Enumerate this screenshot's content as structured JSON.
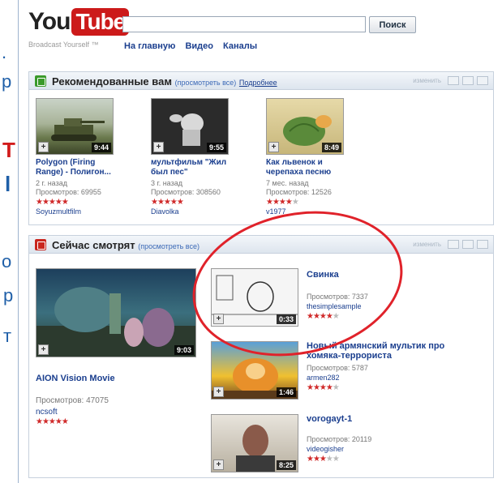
{
  "slide_fragments": {
    "frag1": ".",
    "frag2": "р",
    "frag3": "Т",
    "frag4": "l",
    "frag5": "о",
    "frag6": "р",
    "frag7": "т"
  },
  "header": {
    "logo_you": "You",
    "logo_tube": "Tube",
    "tagline": "Broadcast Yourself ™",
    "search_value": "",
    "search_button": "Поиск",
    "nav": [
      "На главную",
      "Видео",
      "Каналы"
    ]
  },
  "recommended": {
    "title": "Рекомендованные вам",
    "see_all": "(просмотреть все)",
    "more": "Подробнее",
    "edit": "изменить",
    "videos": [
      {
        "title1": "Polygon (Firing",
        "title2": "Range) - Полигон...",
        "age": "2 г. назад",
        "views": "Просмотров: 69955",
        "user": "Soyuzmultfilm",
        "duration": "9:44",
        "rating": 5
      },
      {
        "title1": "мультфильм \"Жил",
        "title2": "был пес\"",
        "age": "3 г. назад",
        "views": "Просмотров: 308560",
        "user": "Diavolka",
        "duration": "9:55",
        "rating": 5
      },
      {
        "title1": "Как львенок и",
        "title2": "черепаха песню",
        "age": "7 мес. назад",
        "views": "Просмотров: 12526",
        "user": "v1977",
        "duration": "8:49",
        "rating": 4.5
      }
    ]
  },
  "now_watching": {
    "title": "Сейчас смотрят",
    "see_all": "(просмотреть все)",
    "edit": "изменить",
    "main": {
      "title": "AION Vision Movie",
      "views": "Просмотров: 47075",
      "user": "ncsoft",
      "duration": "9:03",
      "rating": 5
    },
    "side": [
      {
        "title1": "Свинка",
        "title2": "",
        "views": "Просмотров: 7337",
        "user": "thesimplesample",
        "duration": "0:33",
        "rating": 4
      },
      {
        "title1": "Новый армянский мультик про",
        "title2": "хомяка-террориста",
        "views": "Просмотров: 5787",
        "user": "armen282",
        "duration": "1:46",
        "rating": 4.5
      },
      {
        "title1": "vorogayt-1",
        "title2": "",
        "views": "Просмотров: 20119",
        "user": "videogisher",
        "duration": "8:25",
        "rating": 3
      }
    ]
  },
  "colors": {
    "accent_red": "#cc1a1a",
    "link_blue": "#1a3e8e",
    "annotation": "#e0222a"
  }
}
